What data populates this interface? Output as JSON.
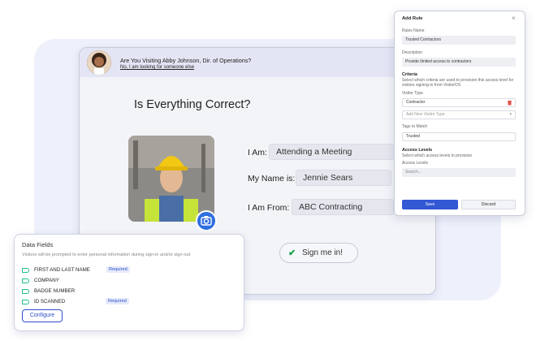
{
  "kiosk": {
    "visit_question": "Are You Visiting Abby Johnson, Dir. of Operations?",
    "visit_no": "No, I am looking for someone else",
    "title": "Is Everything Correct?",
    "fields": [
      {
        "label": "I Am:",
        "value": "Attending a Meeting"
      },
      {
        "label": "My Name is:",
        "value": "Jennie Sears"
      },
      {
        "label": "I Am From:",
        "value": "ABC Contracting"
      }
    ],
    "sign_in_label": "Sign me in!",
    "camera_icon": "camera-icon",
    "check_icon": "check-icon"
  },
  "data_fields": {
    "title": "Data Fields",
    "description": "Visitors will be prompted to enter personal information during sign-in and/or sign-out",
    "items": [
      {
        "name": "FIRST AND LAST NAME",
        "badge": "Required"
      },
      {
        "name": "COMPANY",
        "badge": ""
      },
      {
        "name": "BADGE NUMBER",
        "badge": ""
      },
      {
        "name": "ID SCANNED",
        "badge": "Required"
      }
    ],
    "configure_label": "Configure",
    "tag_icon": "tag-icon",
    "tag_color": "#1bbf8a"
  },
  "add_rule": {
    "title": "Add Rule",
    "close_icon": "close-icon",
    "rule_name_label": "Rules Name",
    "rule_name_value": "Trusted Contractors",
    "description_label": "Description",
    "description_value": "Provide limited access to contractors",
    "criteria_title": "Criteria",
    "criteria_desc": "Select which criteria are used to provision this access level for visitors signing-in from VisitorOS",
    "visitor_type_label": "Visitor Type",
    "visitor_type_value": "Contractor",
    "add_visitor_type_placeholder": "Add New Visitor Type",
    "tags_label": "Tags to Match",
    "tags_value": "Trusted",
    "access_levels_title": "Access Levels",
    "access_levels_desc": "Select which access levels to provision",
    "access_levels_label": "Access Levels",
    "search_placeholder": "Search...",
    "save_label": "Save",
    "discard_label": "Discard",
    "accent_color": "#3358d4"
  }
}
